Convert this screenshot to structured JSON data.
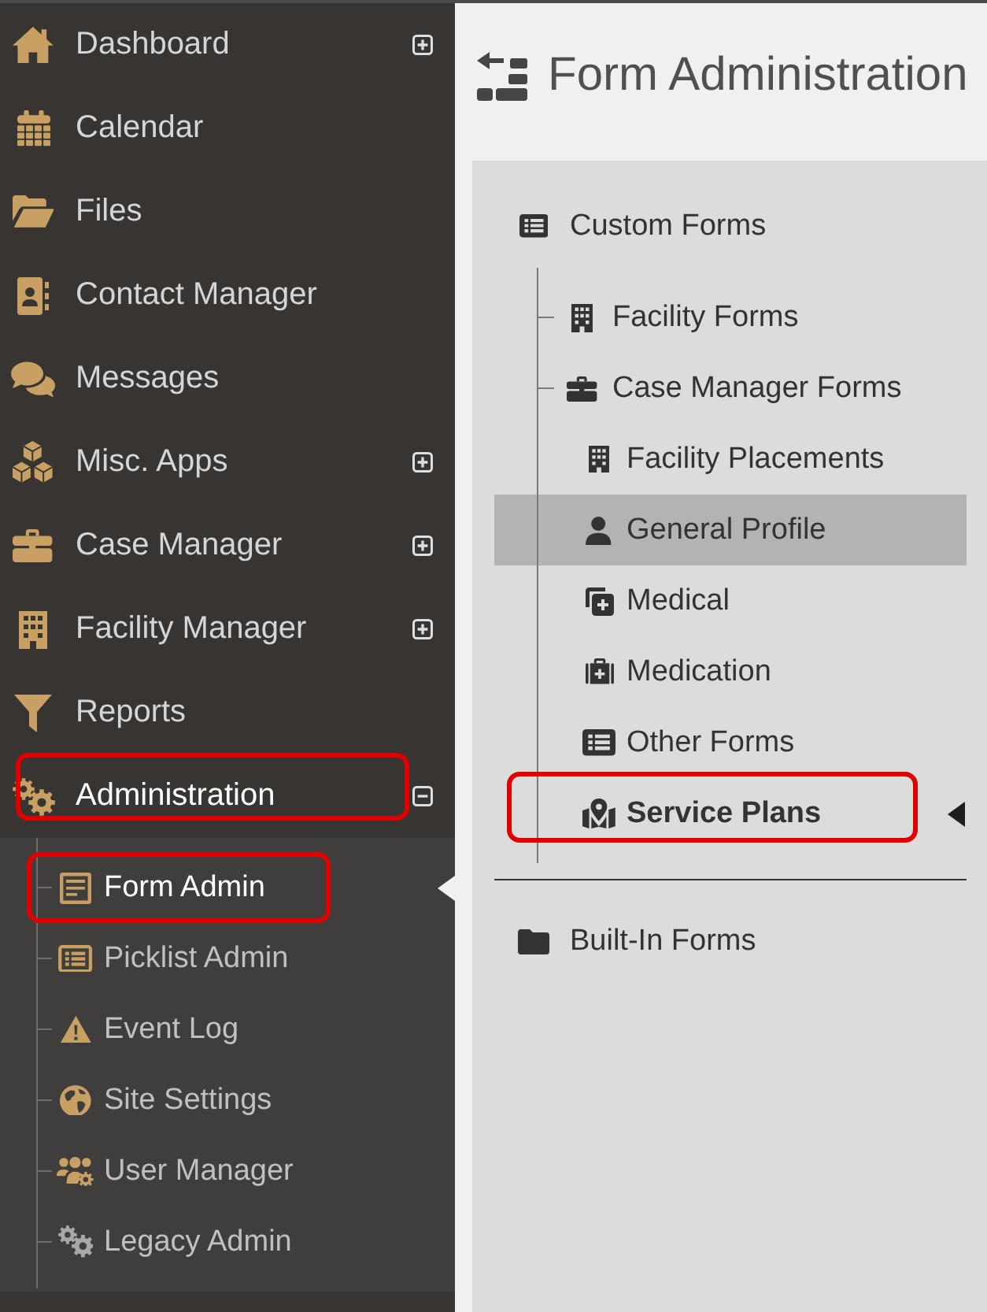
{
  "sidebar": {
    "items": [
      {
        "label": "Dashboard",
        "kind": "group",
        "expanded": false,
        "annotated": false
      },
      {
        "label": "Calendar",
        "kind": "link",
        "expanded": false,
        "annotated": false
      },
      {
        "label": "Files",
        "kind": "link",
        "expanded": false,
        "annotated": false
      },
      {
        "label": "Contact Manager",
        "kind": "link",
        "expanded": false,
        "annotated": false
      },
      {
        "label": "Messages",
        "kind": "link",
        "expanded": false,
        "annotated": false
      },
      {
        "label": "Misc. Apps",
        "kind": "group",
        "expanded": false,
        "annotated": false
      },
      {
        "label": "Case Manager",
        "kind": "group",
        "expanded": false,
        "annotated": false
      },
      {
        "label": "Facility Manager",
        "kind": "group",
        "expanded": false,
        "annotated": false
      },
      {
        "label": "Reports",
        "kind": "link",
        "expanded": false,
        "annotated": false
      },
      {
        "label": "Administration",
        "kind": "group",
        "expanded": true,
        "annotated": true,
        "children": [
          {
            "label": "Form Admin",
            "selected": true,
            "annotated": true
          },
          {
            "label": "Picklist Admin",
            "selected": false,
            "annotated": false
          },
          {
            "label": "Event Log",
            "selected": false,
            "annotated": false
          },
          {
            "label": "Site Settings",
            "selected": false,
            "annotated": false
          },
          {
            "label": "User Manager",
            "selected": false,
            "annotated": false
          },
          {
            "label": "Legacy Admin",
            "selected": false,
            "annotated": false
          }
        ]
      }
    ]
  },
  "main": {
    "title": "Form Administration",
    "tree": {
      "items": [
        {
          "label": "Custom Forms",
          "selected": false,
          "hovered": false,
          "annotated": false,
          "children": [
            {
              "label": "Facility Forms",
              "selected": false,
              "hovered": false,
              "annotated": false
            },
            {
              "label": "Case Manager Forms",
              "selected": false,
              "hovered": false,
              "annotated": false,
              "children": [
                {
                  "label": "Facility Placements",
                  "selected": false,
                  "hovered": false,
                  "annotated": false
                },
                {
                  "label": "General Profile",
                  "selected": false,
                  "hovered": true,
                  "annotated": false
                },
                {
                  "label": "Medical",
                  "selected": false,
                  "hovered": false,
                  "annotated": false
                },
                {
                  "label": "Medication",
                  "selected": false,
                  "hovered": false,
                  "annotated": false
                },
                {
                  "label": "Other Forms",
                  "selected": false,
                  "hovered": false,
                  "annotated": false
                },
                {
                  "label": "Service Plans",
                  "selected": true,
                  "hovered": false,
                  "annotated": true
                }
              ]
            }
          ]
        },
        {
          "label": "Built-In Forms",
          "selected": false,
          "hovered": false,
          "annotated": false
        }
      ]
    }
  }
}
